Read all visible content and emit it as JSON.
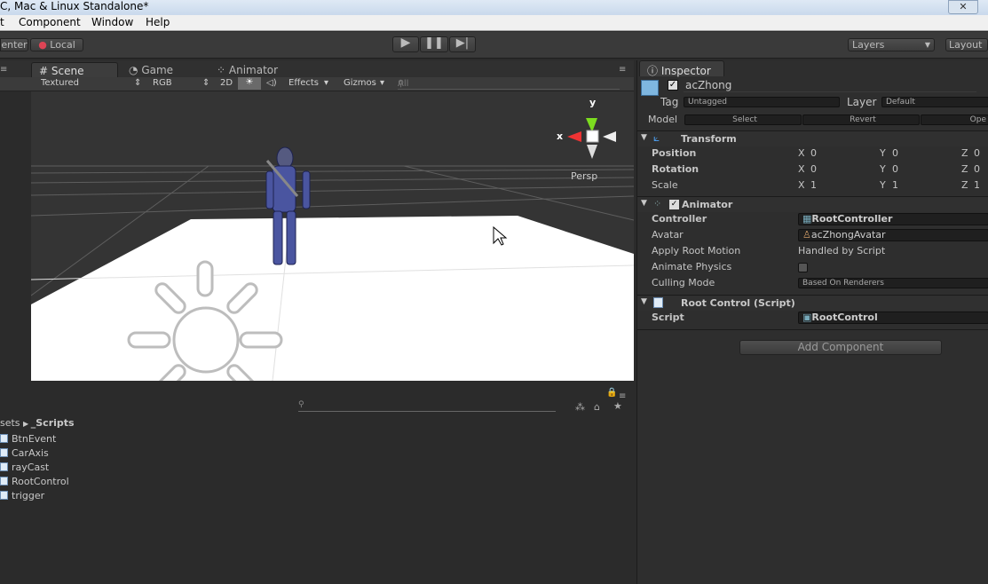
{
  "window": {
    "title": "C, Mac & Linux Standalone*",
    "close_label": "✕"
  },
  "menu": [
    "t",
    "Component",
    "Window",
    "Help"
  ],
  "toolbar": {
    "pivot_label": "enter",
    "space_label": "Local",
    "layers_label": "Layers",
    "layout_label": "Layout"
  },
  "scene": {
    "tabs": [
      "Scene",
      "Game",
      "Animator"
    ],
    "shading": "Textured",
    "render_mode": "RGB",
    "mode_2d": "2D",
    "effects": "Effects",
    "gizmos": "Gizmos",
    "search_placeholder": "All",
    "persp_label": "Persp",
    "axis_x": "x",
    "axis_y": "y"
  },
  "inspector": {
    "tab_label": "Inspector",
    "object_name": "acZhong",
    "tag_label": "Tag",
    "tag_value": "Untagged",
    "layer_label": "Layer",
    "layer_value": "Default",
    "model_label": "Model",
    "model_buttons": [
      "Select",
      "Revert",
      "Ope"
    ],
    "transform": {
      "title": "Transform",
      "rows": [
        {
          "label": "Position",
          "x": "0",
          "y": "0",
          "z": "0"
        },
        {
          "label": "Rotation",
          "x": "0",
          "y": "0",
          "z": "0"
        },
        {
          "label": "Scale",
          "x": "1",
          "y": "1",
          "z": "1"
        }
      ]
    },
    "animator": {
      "title": "Animator",
      "controller_label": "Controller",
      "controller_value": "RootController",
      "avatar_label": "Avatar",
      "avatar_value": "acZhongAvatar",
      "apply_root_label": "Apply Root Motion",
      "apply_root_value": "Handled by Script",
      "animate_physics_label": "Animate Physics",
      "culling_label": "Culling Mode",
      "culling_value": "Based On Renderers"
    },
    "root_control": {
      "title": "Root Control (Script)",
      "script_label": "Script",
      "script_value": "RootControl"
    },
    "add_component": "Add Component"
  },
  "project": {
    "breadcrumb_root": "sets",
    "breadcrumb_folder": "_Scripts",
    "assets": [
      "BtnEvent",
      "CarAxis",
      "rayCast",
      "RootControl",
      "trigger"
    ]
  }
}
